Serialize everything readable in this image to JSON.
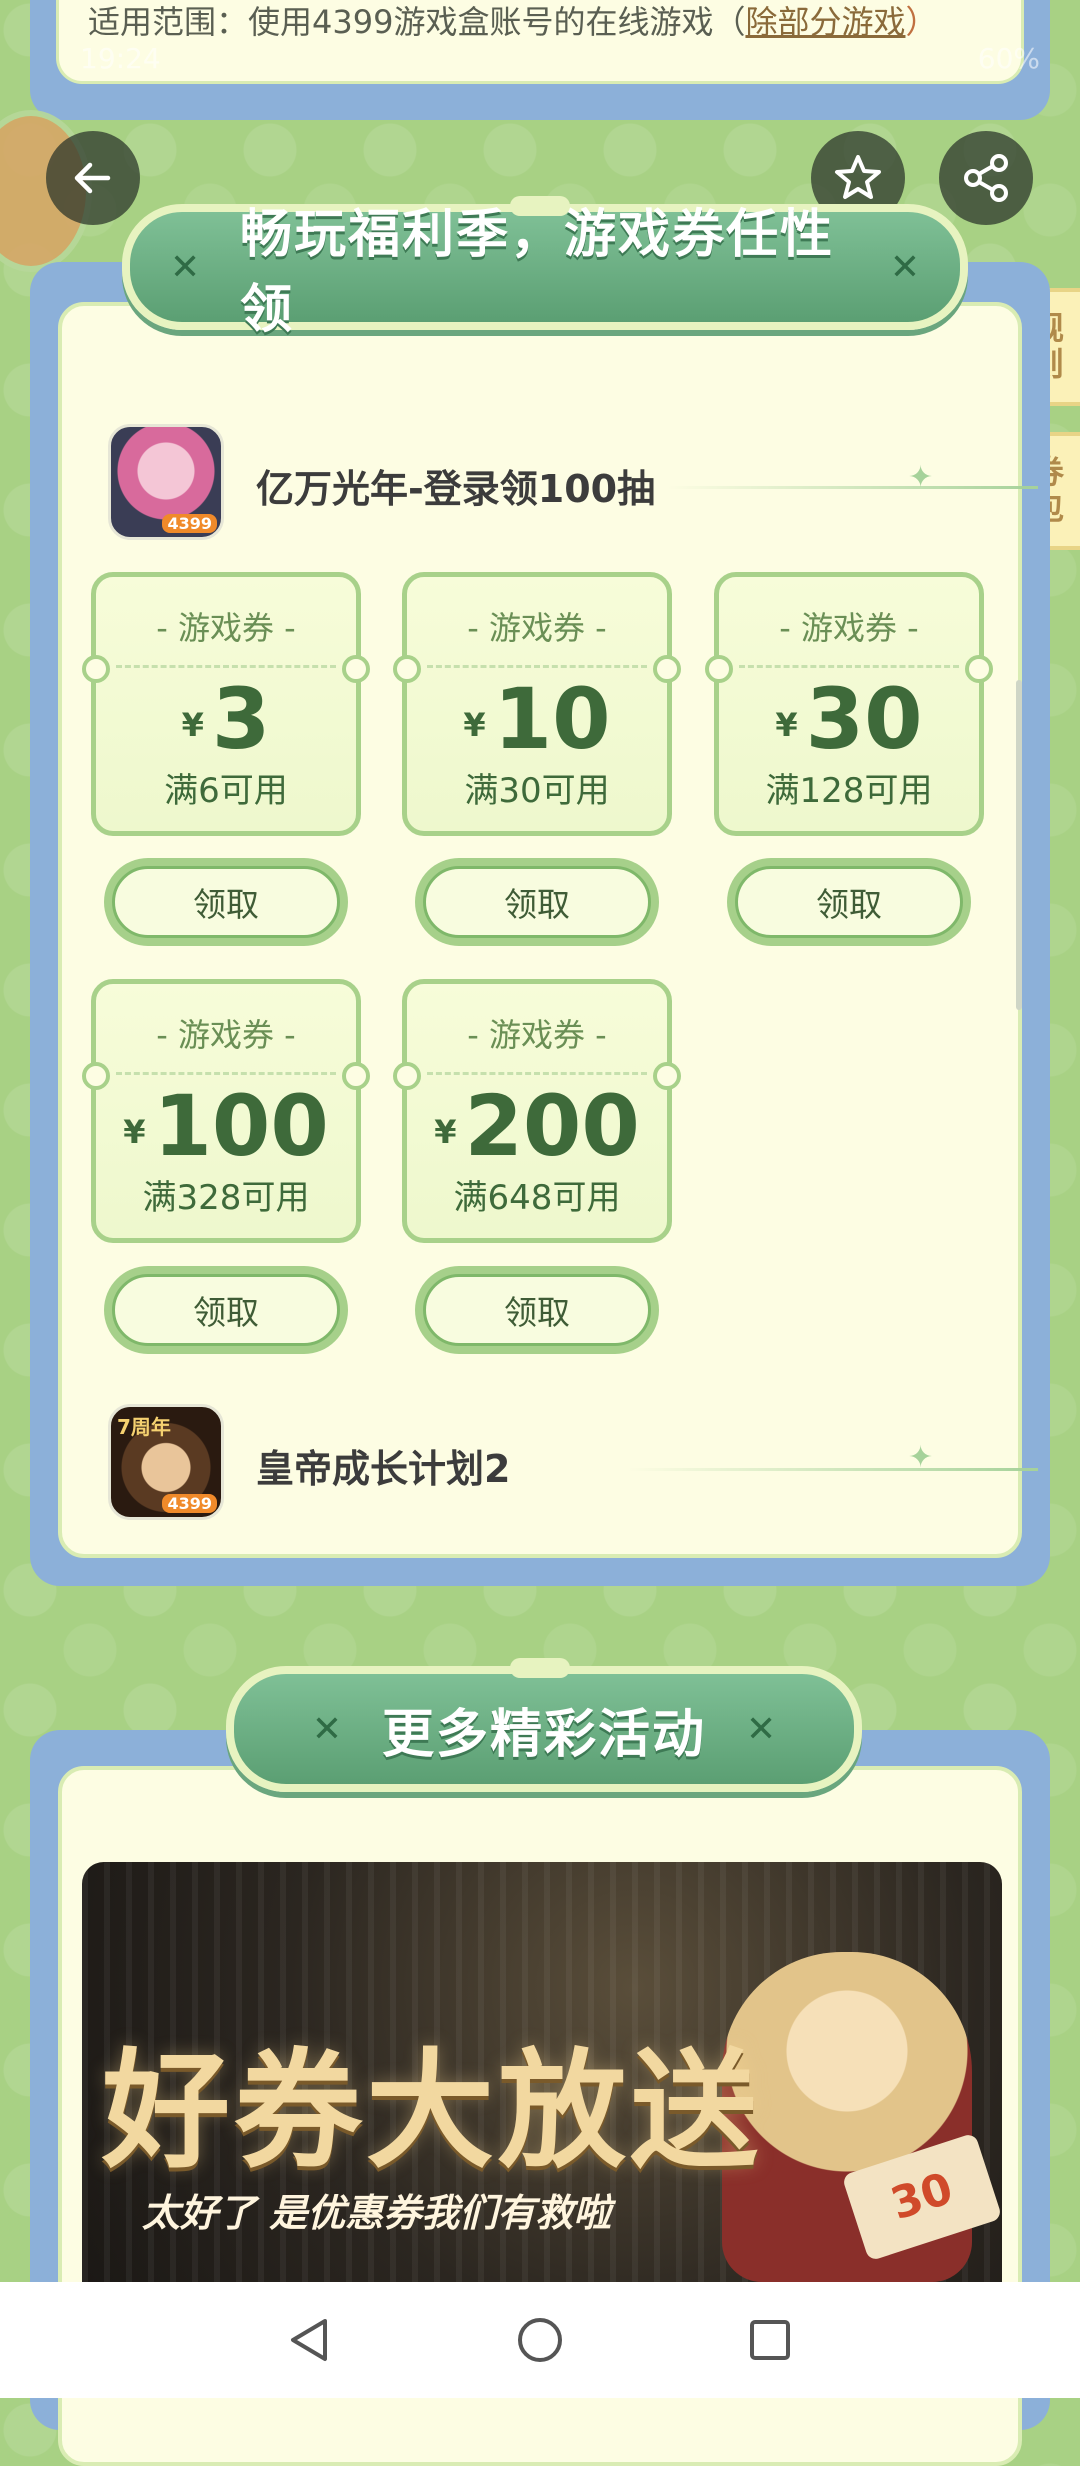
{
  "top": {
    "scope_prefix": "适用范围：使用4399游戏盒账号的在线游戏（",
    "scope_link": "除部分游戏",
    "scope_suffix": "）"
  },
  "status": {
    "time": "19:24",
    "battery": "60%"
  },
  "icons": {
    "back": "arrow-left-icon",
    "star": "star-icon",
    "share": "share-icon",
    "nav_back": "triangle-back-icon",
    "nav_home": "circle-home-icon",
    "nav_recent": "square-recent-icon"
  },
  "side_tabs": {
    "rules": "规则",
    "wallet": "券包"
  },
  "section1": {
    "banner": "畅玩福利季，游戏券任性领",
    "games": [
      {
        "title": "亿万光年-登录领100抽",
        "badge": "4399",
        "coupons": [
          {
            "label": "- 游戏券 -",
            "currency": "¥",
            "amount": "3",
            "condition": "满6可用",
            "button": "领取"
          },
          {
            "label": "- 游戏券 -",
            "currency": "¥",
            "amount": "10",
            "condition": "满30可用",
            "button": "领取"
          },
          {
            "label": "- 游戏券 -",
            "currency": "¥",
            "amount": "30",
            "condition": "满128可用",
            "button": "领取"
          },
          {
            "label": "- 游戏券 -",
            "currency": "¥",
            "amount": "100",
            "condition": "满328可用",
            "button": "领取"
          },
          {
            "label": "- 游戏券 -",
            "currency": "¥",
            "amount": "200",
            "condition": "满648可用",
            "button": "领取"
          }
        ]
      },
      {
        "title": "皇帝成长计划2",
        "badge": "4399",
        "icon_text": "7周年"
      }
    ]
  },
  "section2": {
    "banner": "更多精彩活动",
    "promo": {
      "title": "好券大放送",
      "subtitle": "太好了 是优惠券我们有救啦",
      "ticket_value": "30"
    }
  },
  "colors": {
    "background": "#a8d184",
    "card_border": "#8cb0d9",
    "card_fill": "#fdfde3",
    "banner_green": "#5b9f73",
    "coupon_text": "#3e6a3a"
  }
}
